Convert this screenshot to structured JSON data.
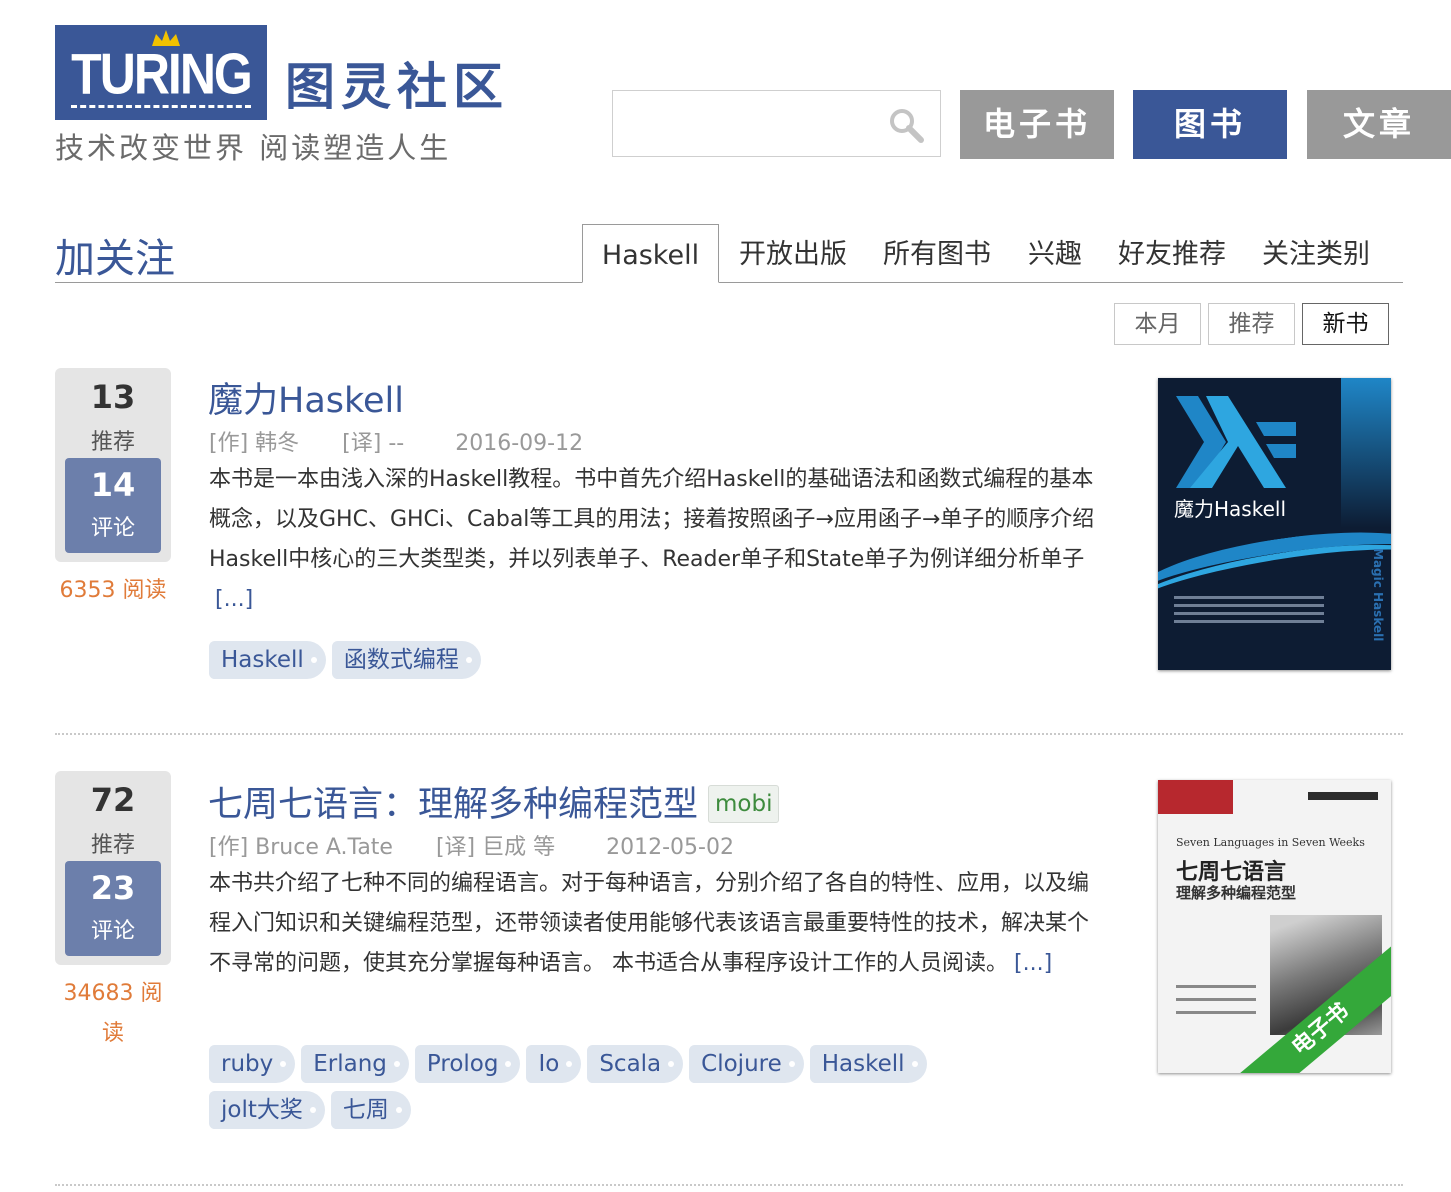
{
  "header": {
    "logo_word": "TURING",
    "logo_cn": "图灵社区",
    "slogan": "技术改变世界 阅读塑造人生",
    "search_placeholder": "",
    "buttons": [
      "电子书",
      "图书",
      "文章"
    ]
  },
  "follow": {
    "label": "加关注"
  },
  "tabs": [
    "Haskell",
    "开放出版",
    "所有图书",
    "兴趣",
    "好友推荐",
    "关注类别"
  ],
  "active_tab": "Haskell",
  "subtabs": [
    "本月",
    "推荐",
    "新书"
  ],
  "active_subtab": "新书",
  "books": [
    {
      "recommend_count": "13",
      "recommend_label": "推荐",
      "comment_count": "14",
      "comment_label": "评论",
      "reads": "6353 阅读",
      "title": "魔力Haskell",
      "format": "",
      "author": "[作] 韩冬",
      "translator": "[译] --",
      "date": "2016-09-12",
      "description": "本书是一本由浅入深的Haskell教程。书中首先介绍Haskell的基础语法和函数式编程的基本概念，以及GHC、GHCi、Cabal等工具的用法；接着按照函子→应用函子→单子的顺序介绍Haskell中核心的三大类型类，并以列表单子、Reader单子和State单子为例详细分析单子",
      "more": "[...]",
      "tags": [
        "Haskell",
        "函数式编程"
      ],
      "cover": {
        "title": "魔力Haskell",
        "side_text": "Magic Haskell"
      }
    },
    {
      "recommend_count": "72",
      "recommend_label": "推荐",
      "comment_count": "23",
      "comment_label": "评论",
      "reads": "34683 阅读",
      "title": "七周七语言：理解多种编程范型",
      "format": "mobi",
      "author": "[作] Bruce A.Tate",
      "translator": "[译] 巨成 等",
      "date": "2012-05-02",
      "description": "本书共介绍了七种不同的编程语言。对于每种语言，分别介绍了各自的特性、应用，以及编程入门知识和关键编程范型，还带领读者使用能够代表该语言最重要特性的技术，解决某个不寻常的问题，使其充分掌握每种语言。 本书适合从事程序设计工作的人员阅读。",
      "more": "[...]",
      "tags": [
        "ruby",
        "Erlang",
        "Prolog",
        "Io",
        "Scala",
        "Clojure",
        "Haskell",
        "jolt大奖",
        "七周"
      ],
      "cover": {
        "en_title": "Seven Languages in Seven Weeks",
        "title": "七周七语言",
        "subtitle": "理解多种编程范型",
        "ribbon": "电子书"
      }
    }
  ],
  "colors": {
    "brand_blue": "#3a5797",
    "button_gray": "#999999",
    "reads_orange": "#e07b39",
    "tag_bg": "#dfe6ef",
    "ebook_green": "#34a83a"
  }
}
